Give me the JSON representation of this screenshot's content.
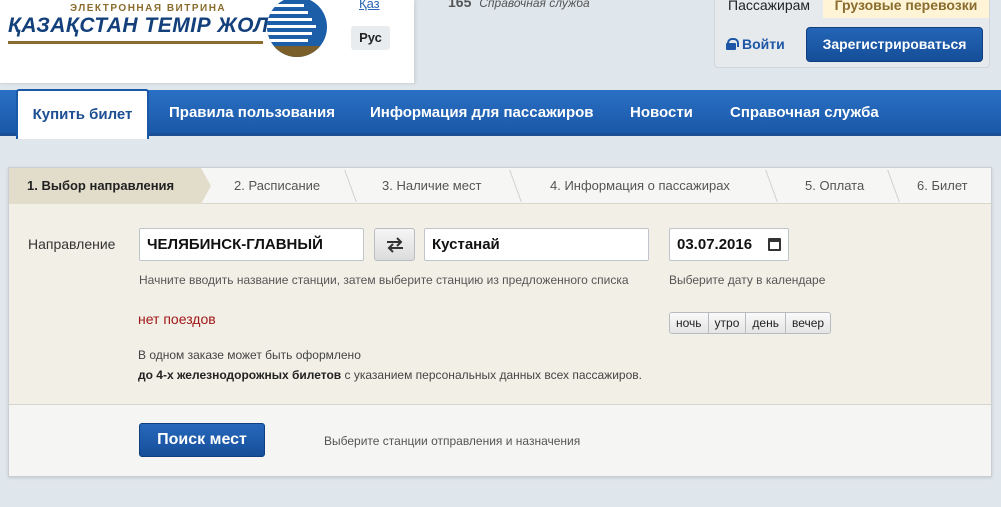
{
  "header": {
    "logo_subtitle": "ЭЛЕКТРОННАЯ ВИТРИНА",
    "logo_title": "ҚАЗАҚСТАН ТЕМІР ЖОЛЫ",
    "lang_kaz": "Қаз",
    "lang_rus": "Рус",
    "hotline_number": "165",
    "hotline_label": "Справочная служба"
  },
  "auth": {
    "tab_passengers": "Пассажирам",
    "tab_cargo": "Грузовые перевозки",
    "login_label": "Войти",
    "register_label": "Зарегистрироваться"
  },
  "nav": {
    "active": "Купить билет",
    "items": [
      "Правила пользования",
      "Информация для пассажиров",
      "Новости",
      "Справочная служба"
    ]
  },
  "steps": [
    "1. Выбор направления",
    "2. Расписание",
    "3. Наличие мест",
    "4. Информация о пассажирах",
    "5. Оплата",
    "6. Билет"
  ],
  "form": {
    "direction_label": "Направление",
    "from_value": "ЧЕЛЯБИНСК-ГЛАВНЫЙ",
    "to_value": "Кустанай",
    "date_value": "03.07.2016",
    "station_hint": "Начните вводить название станции, затем выберите станцию из предложенного списка",
    "date_hint": "Выберите дату в календаре",
    "no_trains": "нет поездов",
    "time_filters": [
      "ночь",
      "утро",
      "день",
      "вечер"
    ],
    "note_line1": "В одном заказе может быть оформлено",
    "note_bold": "до 4-х железнодорожных билетов",
    "note_rest": " с указанием персональных данных всех пассажиров.",
    "search_button": "Поиск мест",
    "footer_hint": "Выберите станции отправления и назначения"
  },
  "colors": {
    "brand_blue": "#1a58a8",
    "brand_gold": "#8a6d2e",
    "error_red": "#a11818"
  }
}
